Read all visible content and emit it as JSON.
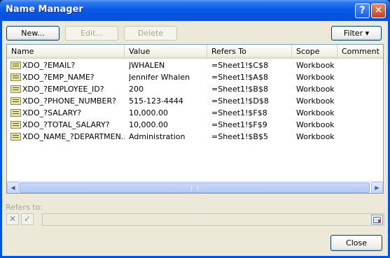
{
  "window": {
    "title": "Name Manager",
    "help_label": "?",
    "close_label": "✕"
  },
  "toolbar": {
    "new_label": "New...",
    "edit_label": "Edit...",
    "delete_label": "Delete",
    "filter_label": "Filter ▾"
  },
  "list": {
    "columns": [
      "Name",
      "Value",
      "Refers To",
      "Scope",
      "Comment"
    ],
    "rows": [
      {
        "name": "XDO_?EMAIL?",
        "value": "JWHALEN",
        "refers_to": "=Sheet1!$C$8",
        "scope": "Workbook",
        "comment": ""
      },
      {
        "name": "XDO_?EMP_NAME?",
        "value": "Jennifer Whalen",
        "refers_to": "=Sheet1!$A$8",
        "scope": "Workbook",
        "comment": ""
      },
      {
        "name": "XDO_?EMPLOYEE_ID?",
        "value": "200",
        "refers_to": "=Sheet1!$B$8",
        "scope": "Workbook",
        "comment": ""
      },
      {
        "name": "XDO_?PHONE_NUMBER?",
        "value": "515-123-4444",
        "refers_to": "=Sheet1!$D$8",
        "scope": "Workbook",
        "comment": ""
      },
      {
        "name": "XDO_?SALARY?",
        "value": "10,000.00",
        "refers_to": "=Sheet1!$F$8",
        "scope": "Workbook",
        "comment": ""
      },
      {
        "name": "XDO_?TOTAL_SALARY?",
        "value": "10,000.00",
        "refers_to": "=Sheet1!$F$9",
        "scope": "Workbook",
        "comment": ""
      },
      {
        "name": "XDO_NAME_?DEPARTMEN...",
        "value": "Administration",
        "refers_to": "=Sheet1!$B$5",
        "scope": "Workbook",
        "comment": ""
      }
    ]
  },
  "refers": {
    "label": "Refers to:",
    "value": "",
    "cancel_icon": "x-icon",
    "confirm_icon": "check-icon"
  },
  "footer": {
    "close_label": "Close"
  }
}
